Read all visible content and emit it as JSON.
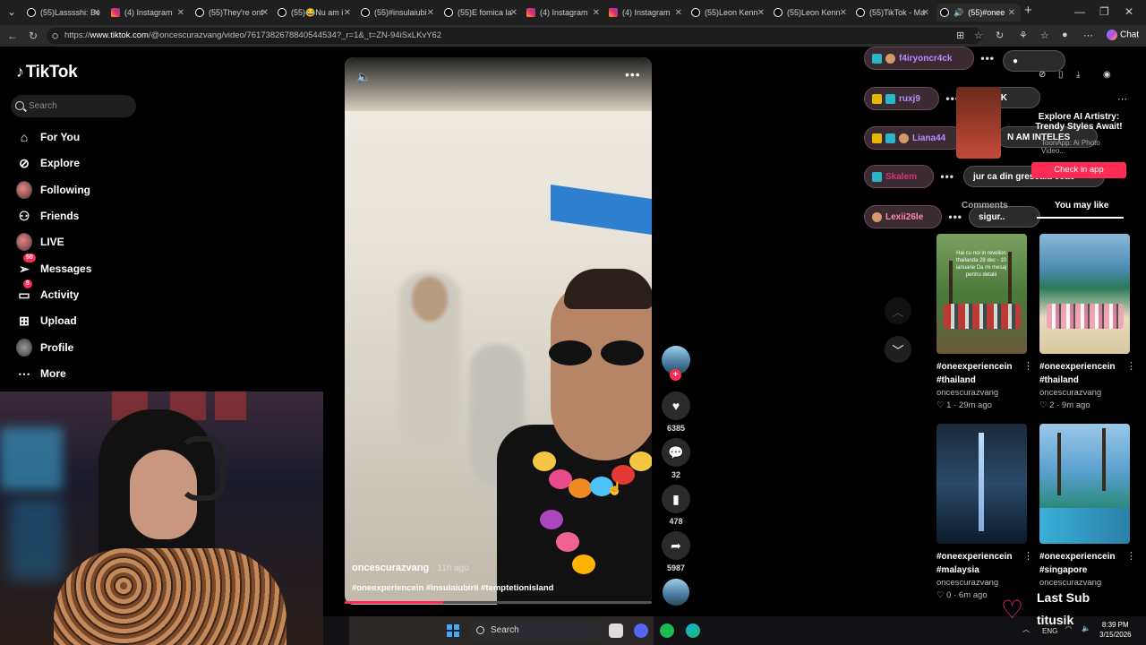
{
  "browser": {
    "tabs": [
      {
        "label": "(55)Lasssshi: Be",
        "icon": "tiktok-icon"
      },
      {
        "label": "(4) Instagram",
        "icon": "instagram-icon"
      },
      {
        "label": "(55)They're ont",
        "icon": "tiktok-icon"
      },
      {
        "label": "(55)😂Nu am i",
        "icon": "tiktok-icon"
      },
      {
        "label": "(55)#insulaiubi",
        "icon": "tiktok-icon"
      },
      {
        "label": "(55)E fomica la",
        "icon": "tiktok-icon"
      },
      {
        "label": "(4) Instagram",
        "icon": "instagram-icon"
      },
      {
        "label": "(4) Instagram",
        "icon": "instagram-icon"
      },
      {
        "label": "(55)Leon Kenn",
        "icon": "tiktok-icon"
      },
      {
        "label": "(55)Leon Kenn",
        "icon": "tiktok-icon"
      },
      {
        "label": "(55)TikTok - Ma",
        "icon": "tiktok-icon"
      },
      {
        "label": "(55)#onee",
        "icon": "tiktok-icon"
      }
    ],
    "url_prefix": "https://",
    "url_host": "www.tiktok.com",
    "url_rest": "/@oncescurazvang/video/7617382678840544534?_r=1&_t=ZN-94iSxLKvY62",
    "chat_label": "Chat"
  },
  "sidebar": {
    "logo_text": "TikTok",
    "search_placeholder": "Search",
    "items": [
      {
        "label": "For You",
        "icon": "home-icon"
      },
      {
        "label": "Explore",
        "icon": "compass-icon"
      },
      {
        "label": "Following",
        "icon": "avatar"
      },
      {
        "label": "Friends",
        "icon": "friends-icon"
      },
      {
        "label": "LIVE",
        "icon": "avatar"
      },
      {
        "label": "Messages",
        "icon": "paper-plane-icon",
        "badge": "50"
      },
      {
        "label": "Activity",
        "icon": "inbox-icon",
        "badge": "5"
      },
      {
        "label": "Upload",
        "icon": "plus-square-icon"
      },
      {
        "label": "Profile",
        "icon": "avatar"
      },
      {
        "label": "More",
        "icon": "more-icon"
      }
    ]
  },
  "video": {
    "author": "oncescurazvang",
    "time_ago": "· 11h ago",
    "hashtags": "#oneexperiencein #insulaiubirii #temptetionisland",
    "progress": 0.32,
    "actions": {
      "likes": "6385",
      "comments": "32",
      "saves": "478",
      "shares": "5987"
    }
  },
  "chat_overlay": {
    "users": [
      {
        "name": "f4iryoncr4ck",
        "color": "#b98cff"
      },
      {
        "name": "ruxj9",
        "color": "#b98cff"
      },
      {
        "name": "Liana44",
        "color": "#b98cff"
      },
      {
        "name": "Skalem",
        "color": "#e0307a"
      },
      {
        "name": "Lexii26le",
        "color": "#ff8aa8"
      }
    ],
    "messages": [
      "OOKK",
      "N AM INTELES",
      "jur ca din greseala coae",
      "sigur.."
    ]
  },
  "ad": {
    "title": "Explore AI Artistry: Trendy Styles Await!",
    "subtitle": "ToonApp: Ai Photo Video...",
    "button": "Check in app"
  },
  "right_panel": {
    "tab_comments": "Comments",
    "tab_you_may_like": "You may like",
    "cards": [
      {
        "title1": "#oneexperiencein",
        "title2": "#thailand",
        "author": "oncescurazvang",
        "likes": "1",
        "ago": "29m ago",
        "overlay": "Hai cu noi in revelion thailanda 28 dec - 10 ianuarie Da mi mesaj pentru detalii"
      },
      {
        "title1": "#oneexperiencein",
        "title2": "#thailand",
        "author": "oncescurazvang",
        "likes": "2",
        "ago": "9m ago",
        "overlay": ""
      },
      {
        "title1": "#oneexperiencein",
        "title2": "#malaysia",
        "author": "oncescurazvang",
        "likes": "0",
        "ago": "6m ago",
        "overlay": ""
      },
      {
        "title1": "#oneexperiencein",
        "title2": "#singapore",
        "author": "oncescurazvang",
        "likes": "",
        "ago": "",
        "overlay": ""
      }
    ]
  },
  "stream_overlay": {
    "last_sub_title": "Last Sub",
    "last_sub_name": "titusik"
  },
  "taskbar": {
    "search_label": "Search",
    "lang": "ENG",
    "time": "8:39 PM",
    "date": "3/15/2026"
  },
  "colors": {
    "accent": "#fe2c55",
    "heart": "#ff2d8e"
  }
}
